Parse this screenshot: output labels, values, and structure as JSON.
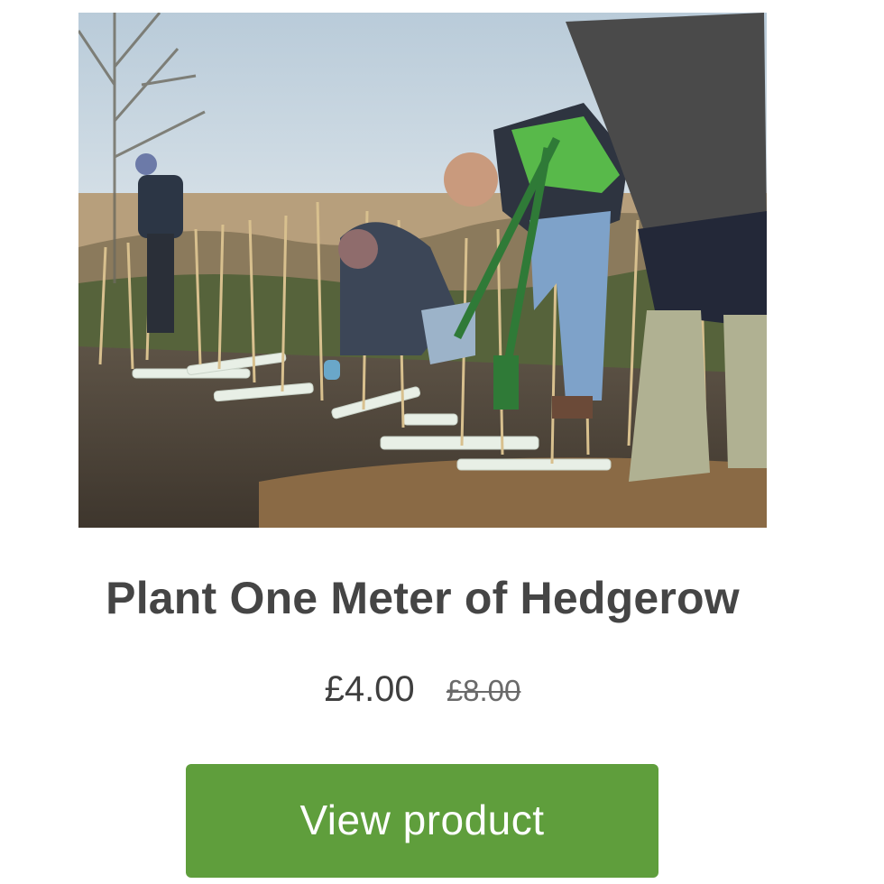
{
  "product": {
    "image_alt": "Volunteers planting a hedgerow",
    "title": "Plant One Meter of Hedgerow",
    "price": {
      "sale": "£4.00",
      "original": "£8.00"
    },
    "cta_label": "View product"
  },
  "colors": {
    "button": "#5f9e3c",
    "button_text": "#ffffff",
    "title": "#454545"
  }
}
